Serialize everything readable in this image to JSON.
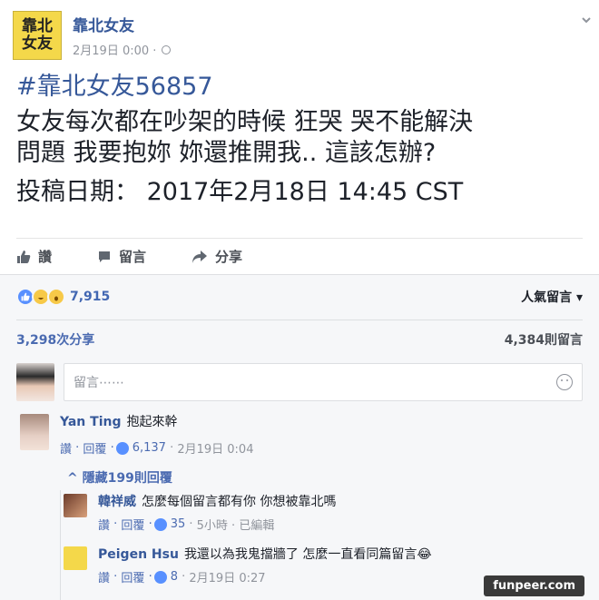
{
  "page": {
    "logo_top": "靠北",
    "logo_bottom": "女友",
    "name": "靠北女友",
    "timestamp": "2月19日 0:00 ·"
  },
  "post": {
    "hashtag": "#靠北女友56857",
    "line1": "女友每次都在吵架的時候 狂哭 哭不能解決",
    "line2": "問題 我要抱妳 妳還推開我.. 這該怎辦?",
    "date": "投稿日期： 2017年2月18日 14:45 CST"
  },
  "actions": {
    "like": "讚",
    "comment": "留言",
    "share": "分享"
  },
  "reactions": {
    "count": "7,915",
    "sort_label": "人氣留言"
  },
  "stats": {
    "shares": "3,298次分享",
    "comments": "4,384則留言"
  },
  "composer": {
    "placeholder": "留言⋯⋯"
  },
  "comments": [
    {
      "name": "Yan Ting",
      "text": "抱起來幹",
      "like": "讚",
      "reply": "回覆",
      "likes": "6,137",
      "time": "2月19日 0:04"
    }
  ],
  "hide_replies": "^ 隱藏199則回覆",
  "replies": [
    {
      "name": "韓祥威",
      "text": "怎麼每個留言都有你 你想被靠北嗎",
      "like": "讚",
      "reply": "回覆",
      "likes": "35",
      "time": "5小時 · 已編輯"
    },
    {
      "name": "Peigen Hsu",
      "text": "我還以為我鬼擋牆了 怎麼一直看同篇留言😂",
      "like": "讚",
      "reply": "回覆",
      "likes": "8",
      "time": "2月19日 0:27"
    }
  ],
  "watermark": "funpeer.com"
}
